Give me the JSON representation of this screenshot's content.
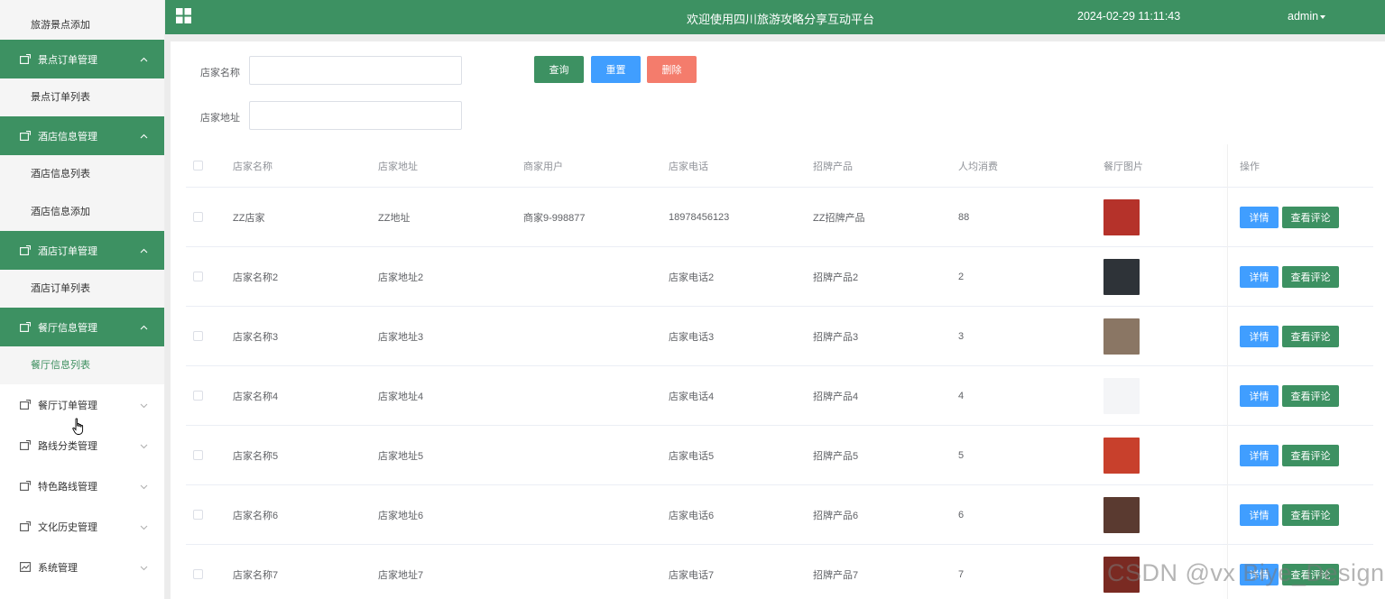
{
  "sidebar": {
    "items": [
      {
        "type": "sub",
        "label": "旅游景点添加"
      },
      {
        "type": "head",
        "label": "景点订单管理",
        "expanded": true
      },
      {
        "type": "sub",
        "label": "景点订单列表"
      },
      {
        "type": "head",
        "label": "酒店信息管理",
        "expanded": true
      },
      {
        "type": "sub",
        "label": "酒店信息列表"
      },
      {
        "type": "sub",
        "label": "酒店信息添加"
      },
      {
        "type": "head",
        "label": "酒店订单管理",
        "expanded": true
      },
      {
        "type": "sub",
        "label": "酒店订单列表"
      },
      {
        "type": "head",
        "label": "餐厅信息管理",
        "expanded": true
      },
      {
        "type": "sub",
        "label": "餐厅信息列表",
        "active": true
      },
      {
        "type": "head",
        "label": "餐厅订单管理",
        "expanded": false
      },
      {
        "type": "head",
        "label": "路线分类管理",
        "expanded": false
      },
      {
        "type": "head",
        "label": "特色路线管理",
        "expanded": false
      },
      {
        "type": "head",
        "label": "文化历史管理",
        "expanded": false
      },
      {
        "type": "head",
        "label": "系统管理",
        "expanded": false
      }
    ]
  },
  "header": {
    "title": "欢迎使用四川旅游攻略分享互动平台",
    "datetime": "2024-02-29 11:11:43",
    "user": "admin"
  },
  "search": {
    "name_label": "店家名称",
    "name_value": "",
    "address_label": "店家地址",
    "address_value": "",
    "query_label": "查询",
    "reset_label": "重置",
    "delete_label": "删除"
  },
  "table": {
    "headers": {
      "name": "店家名称",
      "address": "店家地址",
      "merchant": "商家用户",
      "phone": "店家电话",
      "product": "招牌产品",
      "avg": "人均消费",
      "image": "餐厅图片",
      "ops": "操作"
    },
    "detail_label": "详情",
    "review_label": "查看评论",
    "rows": [
      {
        "name": "ZZ店家",
        "address": "ZZ地址",
        "merchant": "商家9-998877",
        "phone": "18978456123",
        "product": "ZZ招牌产品",
        "avg": "88",
        "image_color": "#b5322a"
      },
      {
        "name": "店家名称2",
        "address": "店家地址2",
        "merchant": "",
        "phone": "店家电话2",
        "product": "招牌产品2",
        "avg": "2",
        "image_color": "#2e3338"
      },
      {
        "name": "店家名称3",
        "address": "店家地址3",
        "merchant": "",
        "phone": "店家电话3",
        "product": "招牌产品3",
        "avg": "3",
        "image_color": "#8a7664"
      },
      {
        "name": "店家名称4",
        "address": "店家地址4",
        "merchant": "",
        "phone": "店家电话4",
        "product": "招牌产品4",
        "avg": "4",
        "image_color": "#f4f5f7"
      },
      {
        "name": "店家名称5",
        "address": "店家地址5",
        "merchant": "",
        "phone": "店家电话5",
        "product": "招牌产品5",
        "avg": "5",
        "image_color": "#c8402c"
      },
      {
        "name": "店家名称6",
        "address": "店家地址6",
        "merchant": "",
        "phone": "店家电话6",
        "product": "招牌产品6",
        "avg": "6",
        "image_color": "#5a3a30"
      },
      {
        "name": "店家名称7",
        "address": "店家地址7",
        "merchant": "",
        "phone": "店家电话7",
        "product": "招牌产品7",
        "avg": "7",
        "image_color": "#7a2a22"
      }
    ]
  },
  "watermark": "CSDN @vx Biye_Design",
  "colors": {
    "brand_green": "#3d9162",
    "primary_blue": "#409eff",
    "danger_red": "#f47c6c"
  }
}
